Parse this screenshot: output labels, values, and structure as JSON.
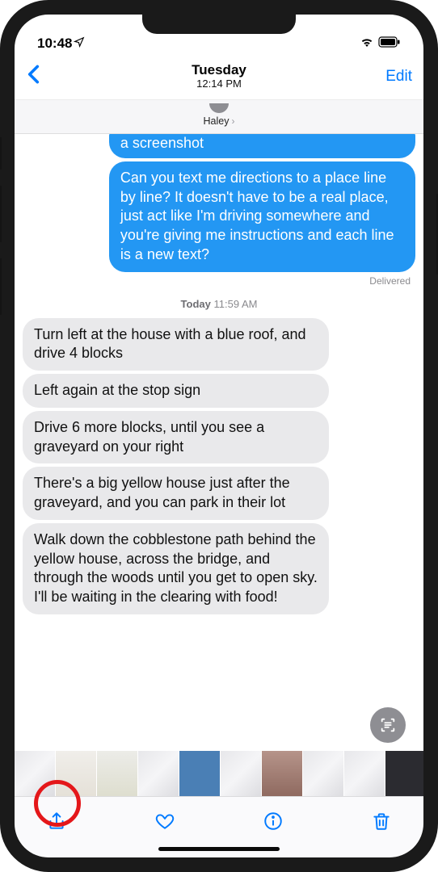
{
  "status": {
    "time": "10:48",
    "location_icon": "◀",
    "wifi": "wifi",
    "battery": "battery"
  },
  "nav": {
    "day": "Tuesday",
    "time": "12:14 PM",
    "edit": "Edit"
  },
  "contact": {
    "name": "Haley"
  },
  "messages": {
    "sent_cut": "a screenshot",
    "sent1": "Can you text me directions to a place line by line? It doesn't have to be a real place, just act like I'm driving somewhere and you're giving me instructions and each line is a new text?",
    "delivered": "Delivered",
    "ts_day": "Today",
    "ts_time": "11:59 AM",
    "r1": "Turn left at the house with a blue roof, and drive 4 blocks",
    "r2": "Left again at the stop sign",
    "r3": "Drive 6 more blocks, until you see a graveyard on your right",
    "r4": "There's a big yellow house just after the graveyard, and you can park in their lot",
    "r5": "Walk down the cobblestone path behind the yellow house, across the bridge, and through the woods until you get to open sky. I'll be waiting in the clearing with food!"
  },
  "toolbar": {
    "share": "share-icon",
    "like": "heart-icon",
    "info": "info-icon",
    "delete": "trash-icon"
  }
}
